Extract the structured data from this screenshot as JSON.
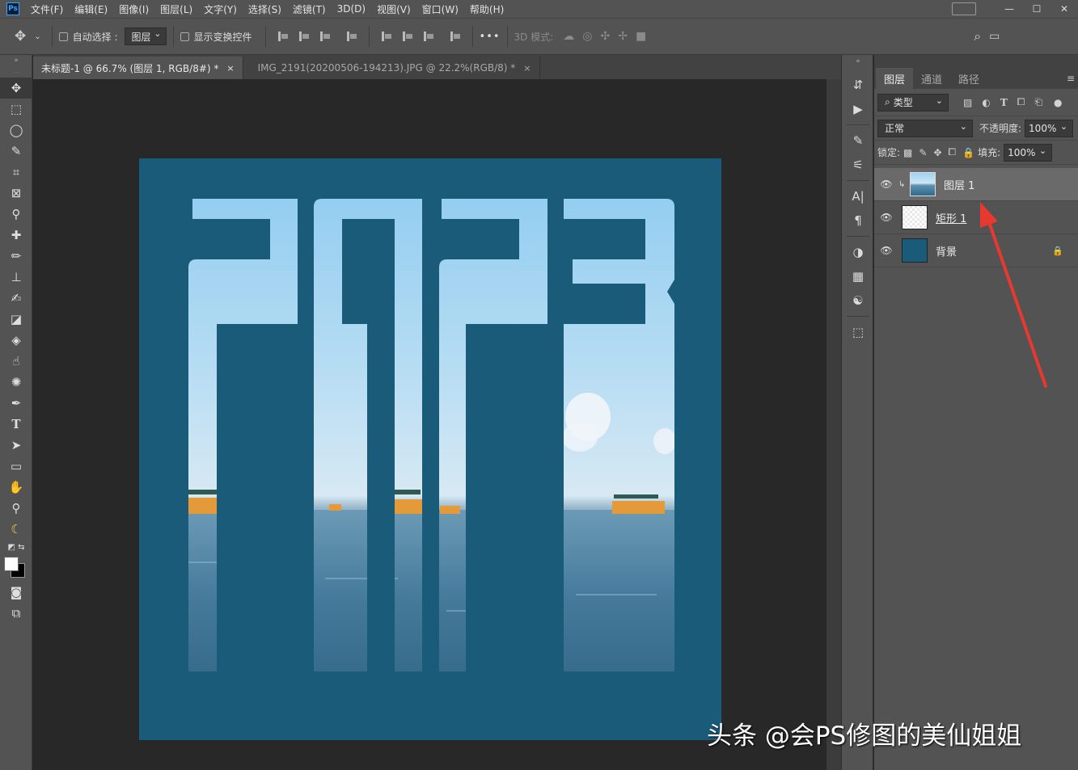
{
  "menubar": {
    "logo": "Ps",
    "items": [
      "文件(F)",
      "编辑(E)",
      "图像(I)",
      "图层(L)",
      "文字(Y)",
      "选择(S)",
      "滤镜(T)",
      "3D(D)",
      "视图(V)",
      "窗口(W)",
      "帮助(H)"
    ]
  },
  "options": {
    "auto_select_label": "自动选择 :",
    "auto_select_target": "图层",
    "show_transform_label": "显示变换控件",
    "mode_3d_label": "3D 模式:",
    "more_icon": "•••"
  },
  "tabs": [
    {
      "label": "未标题-1 @ 66.7% (图层 1, RGB/8#) *",
      "close": "×"
    },
    {
      "label": "IMG_2191(20200506-194213).JPG @ 22.2%(RGB/8) *",
      "close": "×"
    }
  ],
  "canvas": {
    "poster_text": "2023",
    "background_color": "#1a5b7a"
  },
  "layers_panel": {
    "tabs": [
      "图层",
      "通道",
      "路径"
    ],
    "filter_type": "类型",
    "blend_mode": "正常",
    "opacity_label": "不透明度:",
    "opacity_value": "100%",
    "lock_label": "锁定:",
    "fill_label": "填充:",
    "fill_value": "100%",
    "layers": [
      {
        "name": "图层 1"
      },
      {
        "name": "矩形 1"
      },
      {
        "name": "背景"
      }
    ]
  },
  "watermark": "头条 @会PS修图的美仙姐姐",
  "colors": {
    "accent_arrow": "#e8382f",
    "panel_bg": "#535353",
    "canvas_bg": "#282828"
  }
}
